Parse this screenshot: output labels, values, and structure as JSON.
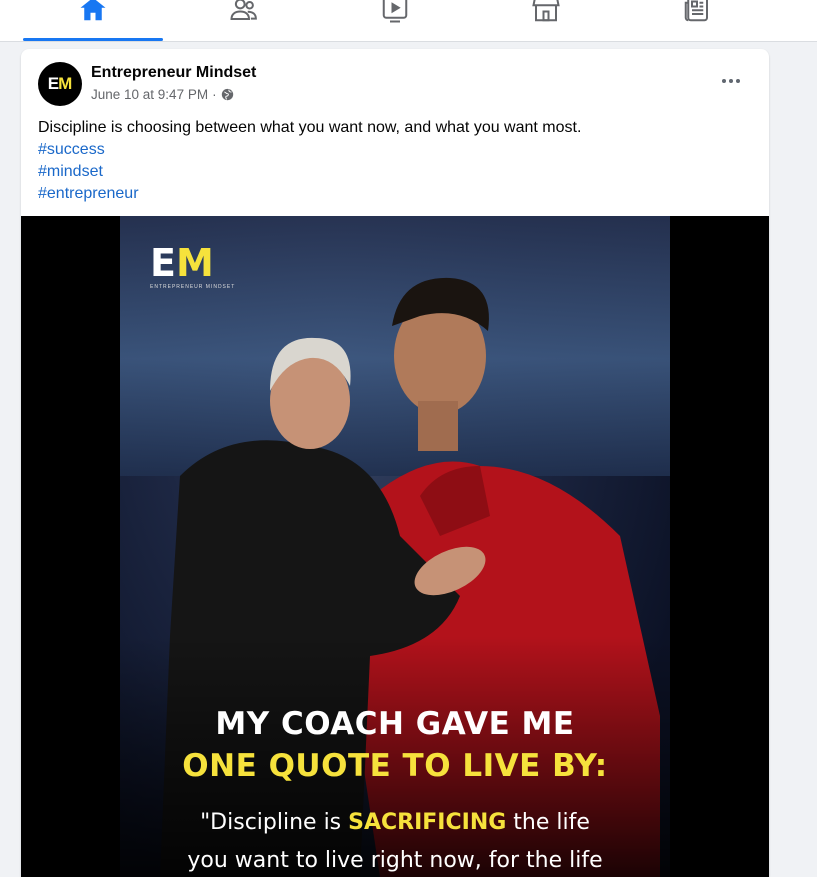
{
  "nav": {
    "tabs": [
      {
        "name": "home",
        "icon": "home-icon",
        "active": true
      },
      {
        "name": "friends",
        "icon": "friends-icon",
        "active": false
      },
      {
        "name": "watch",
        "icon": "video-icon",
        "active": false
      },
      {
        "name": "marketplace",
        "icon": "marketplace-icon",
        "active": false
      },
      {
        "name": "news",
        "icon": "news-icon",
        "active": false
      }
    ],
    "accent": "#1877f2"
  },
  "post": {
    "author": "Entrepreneur Mindset",
    "avatar_text_e": "E",
    "avatar_text_m": "M",
    "timestamp": "June 10 at 9:47 PM",
    "separator": "·",
    "audience_icon": "globe-icon",
    "body": "Discipline is choosing between what you want now, and what you want most.",
    "hashtags": [
      "#success",
      "#mindset",
      "#entrepreneur"
    ],
    "more_icon": "more-options-icon"
  },
  "image": {
    "logo_e": "E",
    "logo_m": "M",
    "logo_caption": "ENTREPRENEUR MINDSET",
    "headline_1": "MY COACH GAVE ME",
    "headline_2": "ONE QUOTE TO LIVE BY:",
    "quote_1_pre": "\"Discipline is ",
    "quote_1_hl": "SACRIFICING",
    "quote_1_post": " the life",
    "quote_2": "you want to live right now, for the life",
    "colors": {
      "white": "#ffffff",
      "yellow": "#f6e23c",
      "link": "#1a68c9"
    }
  }
}
